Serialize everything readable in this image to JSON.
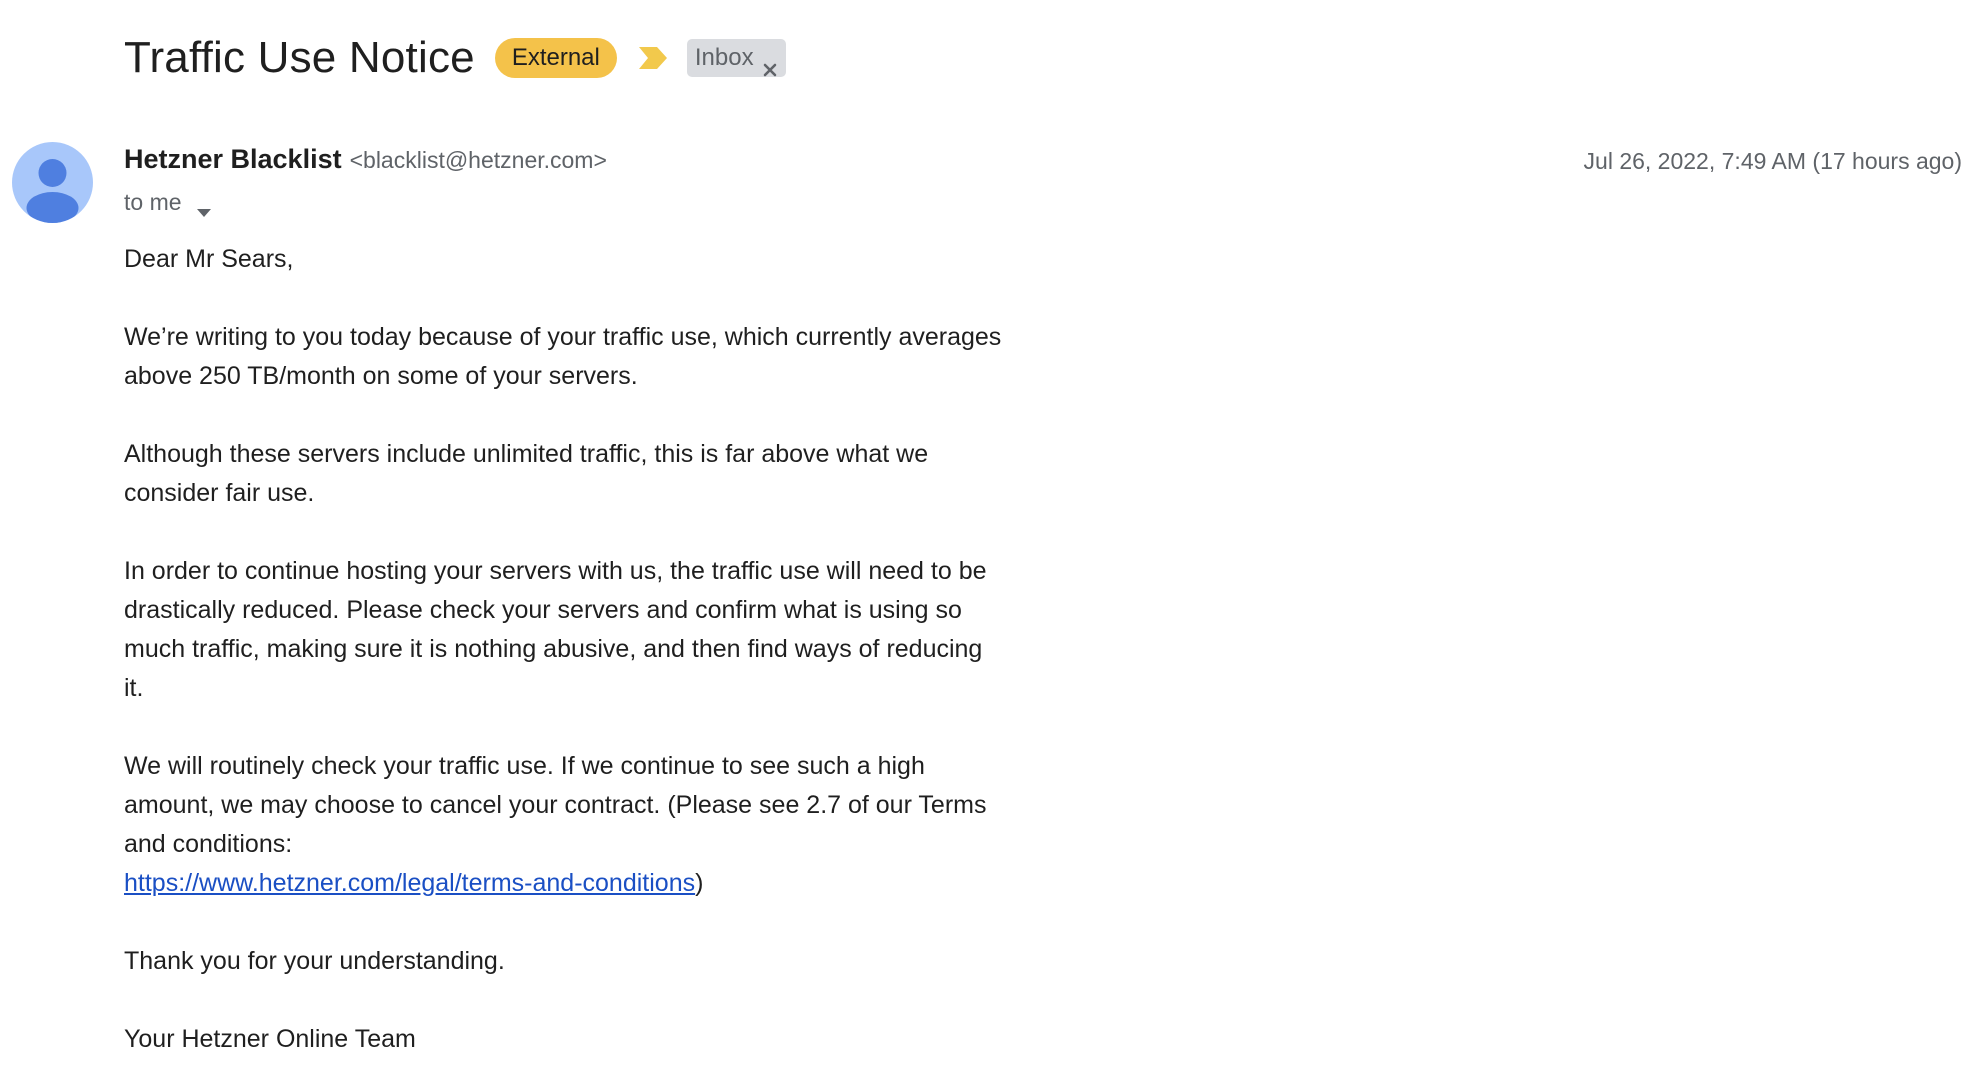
{
  "subject": {
    "title": "Traffic Use Notice",
    "labels": {
      "external": "External",
      "inbox": "Inbox"
    },
    "importance_icon": "importance-marker-icon",
    "colors": {
      "external_label_bg": "#f4c24a",
      "importance_marker": "#f2c94c",
      "inbox_label_bg": "#dadce0"
    }
  },
  "message": {
    "sender": {
      "name": "Hetzner Blacklist",
      "email": "<blacklist@hetzner.com>",
      "avatar_icon": "default-person-avatar-icon",
      "avatar_colors": {
        "background": "#a8c7fa",
        "figure": "#4f7fe0"
      }
    },
    "date": "Jul 26, 2022, 7:49 AM (17 hours ago)",
    "recipient": "to me",
    "body": {
      "greeting": "Dear Mr Sears,",
      "paragraph1": "We’re writing to you today because of your traffic use, which currently averages above 250 TB/month on some of your servers.",
      "paragraph2": "Although these servers include unlimited traffic, this is far above what we consider fair use.",
      "paragraph3": "In order to continue hosting your servers with us, the traffic use will need to be drastically reduced. Please check your servers and confirm what is using so much traffic, making sure it is nothing abusive, and then find ways of reducing it.",
      "paragraph4_text": "We will routinely check your traffic use. If we continue to see such a high amount, we may choose to cancel your contract. (Please see 2.7 of our Terms and conditions:",
      "paragraph4_link": "https://www.hetzner.com/legal/terms-and-conditions",
      "paragraph4_end": ")",
      "thanks": "Thank you for your understanding.",
      "signature": "Your Hetzner Online Team",
      "link_color": "#1a4fc4"
    }
  }
}
